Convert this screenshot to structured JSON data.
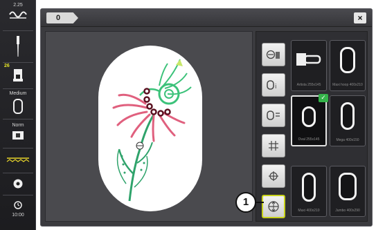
{
  "left_bar": {
    "top_value": "2.25",
    "needle_number": "26",
    "foot_label": "Medium",
    "hoop_label": "Norm",
    "time_value": "10:00"
  },
  "window": {
    "tab_label": "0",
    "close_symbol": "×"
  },
  "tools": [
    {
      "name": "move-hoop-tool",
      "glyph": "⊖"
    },
    {
      "name": "hoop-info-tool",
      "glyph": "Ο"
    },
    {
      "name": "hoop-template-tool",
      "glyph": "Ο"
    },
    {
      "name": "grid-tool",
      "glyph": "#"
    },
    {
      "name": "center-tool",
      "glyph": "⊕"
    },
    {
      "name": "hoop-center-tool",
      "glyph": "⊕"
    }
  ],
  "hoops": [
    {
      "caption": "Artista 255x145",
      "active": false
    },
    {
      "caption": "Maxi hoop 400x210",
      "active": false
    },
    {
      "caption": "Oval 255x145",
      "active": true
    },
    {
      "caption": "Mega 400x150",
      "active": false
    },
    {
      "caption": "Maxi 400x210",
      "active": false
    },
    {
      "caption": "Jumbo 400x290",
      "active": false
    }
  ],
  "callout": {
    "number": "1"
  },
  "colors": {
    "accent_yellow": "#c8d21a",
    "check_green": "#35b34a",
    "bg_dark": "#3b3b3f"
  }
}
